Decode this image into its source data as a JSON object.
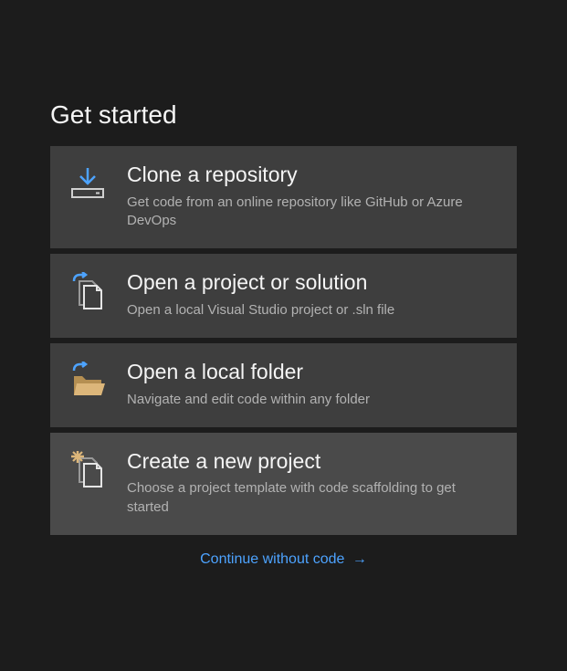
{
  "heading": "Get started",
  "items": [
    {
      "title": "Clone a repository",
      "description": "Get code from an online repository like GitHub or Azure DevOps"
    },
    {
      "title": "Open a project or solution",
      "description": "Open a local Visual Studio project or .sln file"
    },
    {
      "title": "Open a local folder",
      "description": "Navigate and edit code within any folder"
    },
    {
      "title": "Create a new project",
      "description": "Choose a project template with code scaffolding to get started"
    }
  ],
  "continue_label": "Continue without code",
  "colors": {
    "accent": "#4da3ff",
    "bg": "#1c1c1c",
    "card_bg": "#3e3e3e",
    "card_highlight": "#4a4a4a",
    "text_primary": "#f5f5f5",
    "text_secondary": "#b2b2b2",
    "folder": "#dcb67a"
  }
}
